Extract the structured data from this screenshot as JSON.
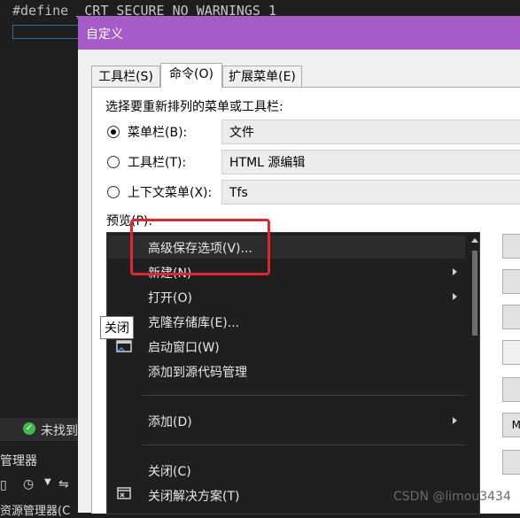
{
  "editor": {
    "code_prefix": "#define ",
    "code_macro": "_CRT_SECURE_NO_WARNINGS",
    "code_value": " 1",
    "status_text": "未找到",
    "manager_label": "管理器",
    "bottom_tab": "资源管理器(C"
  },
  "dialog": {
    "title": "自定义",
    "tabs": [
      {
        "label": "工具栏(S)"
      },
      {
        "label": "命令(O)"
      },
      {
        "label": "扩展菜单(E)"
      }
    ],
    "choose_label": "选择要重新排列的菜单或工具栏:",
    "options": [
      {
        "label": "菜单栏(B):",
        "value": "文件",
        "selected": true
      },
      {
        "label": "工具栏(T):",
        "value": "HTML 源编辑",
        "selected": false
      },
      {
        "label": "上下文菜单(X):",
        "value": "Tfs",
        "selected": false
      }
    ],
    "preview_label": "预览(P):",
    "preview_items": [
      {
        "label": "高级保存选项(V)...",
        "submenu": false
      },
      {
        "label": "新建(N)",
        "submenu": true
      },
      {
        "label": "打开(O)",
        "submenu": true
      },
      {
        "label": "克隆存储库(E)...",
        "submenu": false
      },
      {
        "label": "启动窗口(W)",
        "submenu": false
      },
      {
        "label": "添加到源代码管理",
        "submenu": false
      },
      {
        "label": "添加(D)",
        "submenu": true
      },
      {
        "label": "关闭(C)",
        "submenu": false
      },
      {
        "label": "关闭解决方案(T)",
        "submenu": false
      }
    ],
    "tooltip": "关闭",
    "side_button_text": "M"
  },
  "watermark": "CSDN @limou3434",
  "colors": {
    "titlebar": "#a55bc8",
    "highlight_box": "#e3262b",
    "preview_bg": "#1f1f1f"
  }
}
